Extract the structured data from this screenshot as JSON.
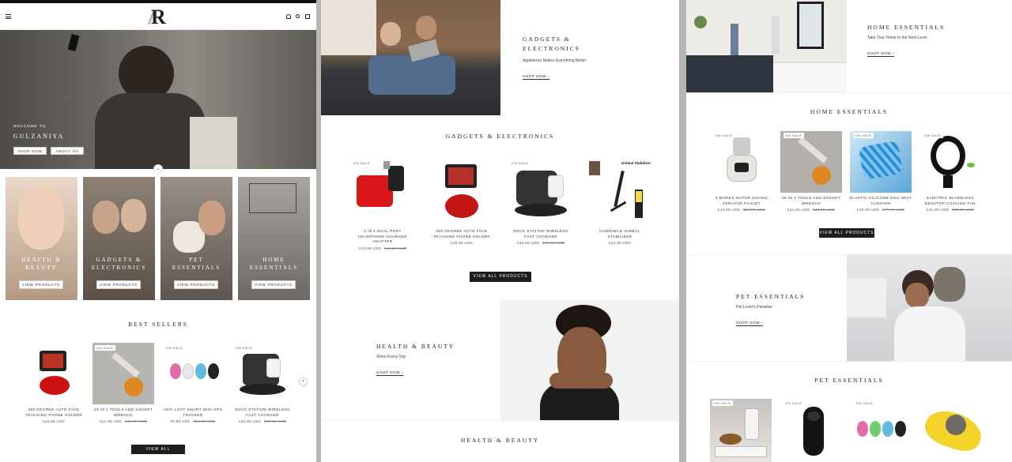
{
  "header": {
    "logo": "R",
    "logo_script": "Gulzaniya"
  },
  "hero": {
    "welcome": "WELCOME TO",
    "title": "GULZANIYA",
    "shop_btn": "SHOP NOW",
    "about_btn": "ABOUT US"
  },
  "categories": [
    {
      "line1": "HEALTH &",
      "line2": "BEAUTY",
      "btn": "VIEW PRODUCTS"
    },
    {
      "line1": "GADGETS &",
      "line2": "ELECTRONICS",
      "btn": "VIEW PRODUCTS"
    },
    {
      "line1": "PET",
      "line2": "ESSENTIALS",
      "btn": "VIEW PRODUCTS"
    },
    {
      "line1": "HOME",
      "line2": "ESSENTIALS",
      "btn": "VIEW PRODUCTS"
    }
  ],
  "bestsellers": {
    "title": "BEST SELLERS",
    "view_all": "VIEW ALL PRODUCTS",
    "products": [
      {
        "badge": "",
        "name1": "360 DEGREE AUTO FACE",
        "name2": "TRACKING PHONE HOLDER",
        "price": "£25.99 USD",
        "old": ""
      },
      {
        "badge": "ON SALE",
        "name1": "48 IN 1 TOOLS AND SOCKET",
        "name2": "WRENCH",
        "price": "£21.99 USD",
        "old": "£43.99 USD"
      },
      {
        "badge": "ON SALE",
        "name1": "ANTI LOST SMART MINI GPS",
        "name2": "TRACKER",
        "price": "£8.99 USD",
        "old": "£19.99 USD"
      },
      {
        "badge": "ON SALE",
        "name1": "DOCK STATION WIRELESS",
        "name2": "FAST CHARGER",
        "price": "£33.99 USD",
        "old": "£47.99 USD"
      }
    ]
  },
  "gadgets_banner": {
    "line1": "GADGETS &",
    "line2": "ELECTRONICS",
    "sub": "Appliances Makes Everything Better",
    "link": "SHOP NOW ›"
  },
  "gadgets": {
    "title": "GADGETS & ELECTRONICS",
    "view_all": "VIEW ALL PRODUCTS",
    "stabilizer_label": "Gimbal Stabilizer",
    "products": [
      {
        "badge": "ON SALE",
        "name1": "2 IN 1 DUAL PORT",
        "name2": "HEADPHONE CHARGER",
        "name3": "ADAPTER",
        "price": "£14.99 USD",
        "old": "£45.99 USD"
      },
      {
        "badge": "",
        "name1": "360 DEGREE AUTO FACE",
        "name2": "TRACKING PHONE HOLDER",
        "name3": "",
        "price": "£25.99 USD",
        "old": ""
      },
      {
        "badge": "ON SALE",
        "name1": "DOCK STATION WIRELESS",
        "name2": "FAST CHARGER",
        "name3": "",
        "price": "£33.99 USD",
        "old": "£47.99 USD"
      },
      {
        "badge": "",
        "name1": "HANDHELD GIMBAL",
        "name2": "STABILIZER",
        "name3": "",
        "price": "£44.99 USD",
        "old": ""
      }
    ]
  },
  "beauty_banner": {
    "title": "HEALTH & BEAUTY",
    "sub": "Shine Every Day",
    "link": "SHOP NOW ›"
  },
  "beauty": {
    "title": "HEALTH & BEAUTY"
  },
  "home_banner": {
    "title": "HOME ESSENTIALS",
    "sub": "Take Your Home to the Next Level",
    "link": "SHOP NOW ›"
  },
  "home": {
    "title": "HOME ESSENTIALS",
    "view_all": "VIEW ALL PRODUCTS",
    "products": [
      {
        "badge": "ON SALE",
        "name1": "3 MODES WATER SAVING",
        "name2": "AERATOR FAUCET",
        "price": "£12.99 USD",
        "old": "£26.99 USD"
      },
      {
        "badge": "ON SALE",
        "name1": "48 IN 1 TOOLS AND SOCKET",
        "name2": "WRENCH",
        "price": "£21.99 USD",
        "old": "£43.99 USD"
      },
      {
        "badge": "ON SALE",
        "name1": "ELASTIC SILICONE EGG SEAT",
        "name2": "CUSHION",
        "price": "£38.99 USD",
        "old": "£77.99 USD"
      },
      {
        "badge": "ON SALE",
        "name1": "ELECTRIC BLADELESS",
        "name2": "DESKTOP COOLING FAN",
        "price": "£31.99 USD",
        "old": "£62.99 USD"
      }
    ]
  },
  "pet_banner": {
    "title": "PET ESSENTIALS",
    "sub": "Pet Lover's Paradise",
    "link": "SHOP NOW ›"
  },
  "pet": {
    "title": "PET ESSENTIALS",
    "badges": [
      "ON SALE",
      "ON SALE",
      "ON SALE",
      ""
    ]
  }
}
